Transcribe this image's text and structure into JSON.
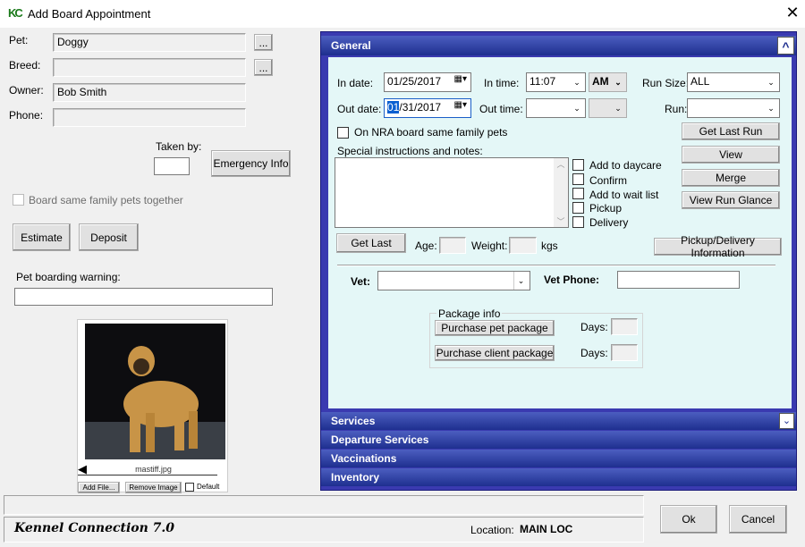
{
  "window": {
    "title": "Add Board Appointment",
    "close": "✕"
  },
  "left": {
    "pet_label": "Pet:",
    "pet_value": "Doggy",
    "breed_label": "Breed:",
    "breed_value": "",
    "owner_label": "Owner:",
    "owner_value": "Bob Smith",
    "phone_label": "Phone:",
    "phone_value": "",
    "browse_label": "...",
    "taken_by_label": "Taken by:",
    "taken_by_value": "",
    "emergency_label": "Emergency Info",
    "family_label": "Board same family pets together",
    "estimate_label": "Estimate",
    "deposit_label": "Deposit",
    "warning_label": "Pet boarding warning:",
    "warning_value": "",
    "image_caption": "mastiff.jpg",
    "add_file_label": "Add File...",
    "remove_image_label": "Remove Image",
    "default_label": "Default"
  },
  "general": {
    "header": "General",
    "collapse": "^",
    "in_date_label": "In date:",
    "in_date": "01/25/2017",
    "in_time_label": "In time:",
    "in_time": "11:07",
    "ampm": "AM",
    "run_size_label": "Run Size:",
    "run_size": "ALL",
    "out_date_label": "Out date:",
    "out_date_sel": "01",
    "out_date_rest": "/31/2017",
    "out_time_label": "Out time:",
    "out_time": "",
    "run_label": "Run:",
    "run_value": "",
    "nra_label": "On NRA board same family pets",
    "notes_label": "Special instructions and notes:",
    "checks": [
      "Add to daycare",
      "Confirm",
      "Add to wait list",
      "Pickup",
      "Delivery"
    ],
    "buttons": [
      "Get Last Run",
      "View",
      "Merge",
      "View Run Glance"
    ],
    "get_last_label": "Get Last",
    "age_label": "Age:",
    "weight_label": "Weight:",
    "kgs_label": "kgs",
    "pickup_delivery_label": "Pickup/Delivery Information",
    "vet_label": "Vet:",
    "vet_phone_label": "Vet Phone:",
    "package_label": "Package info",
    "purchase_pet_label": "Purchase pet package",
    "purchase_client_label": "Purchase client package",
    "days_label": "Days:"
  },
  "sections": [
    {
      "label": "Services"
    },
    {
      "label": "Departure Services"
    },
    {
      "label": "Vaccinations"
    },
    {
      "label": "Inventory"
    }
  ],
  "footer": {
    "brand": "Kennel Connection 7.0",
    "location_label": "Location:",
    "location_value": "MAIN LOC",
    "ok_label": "Ok",
    "cancel_label": "Cancel"
  }
}
